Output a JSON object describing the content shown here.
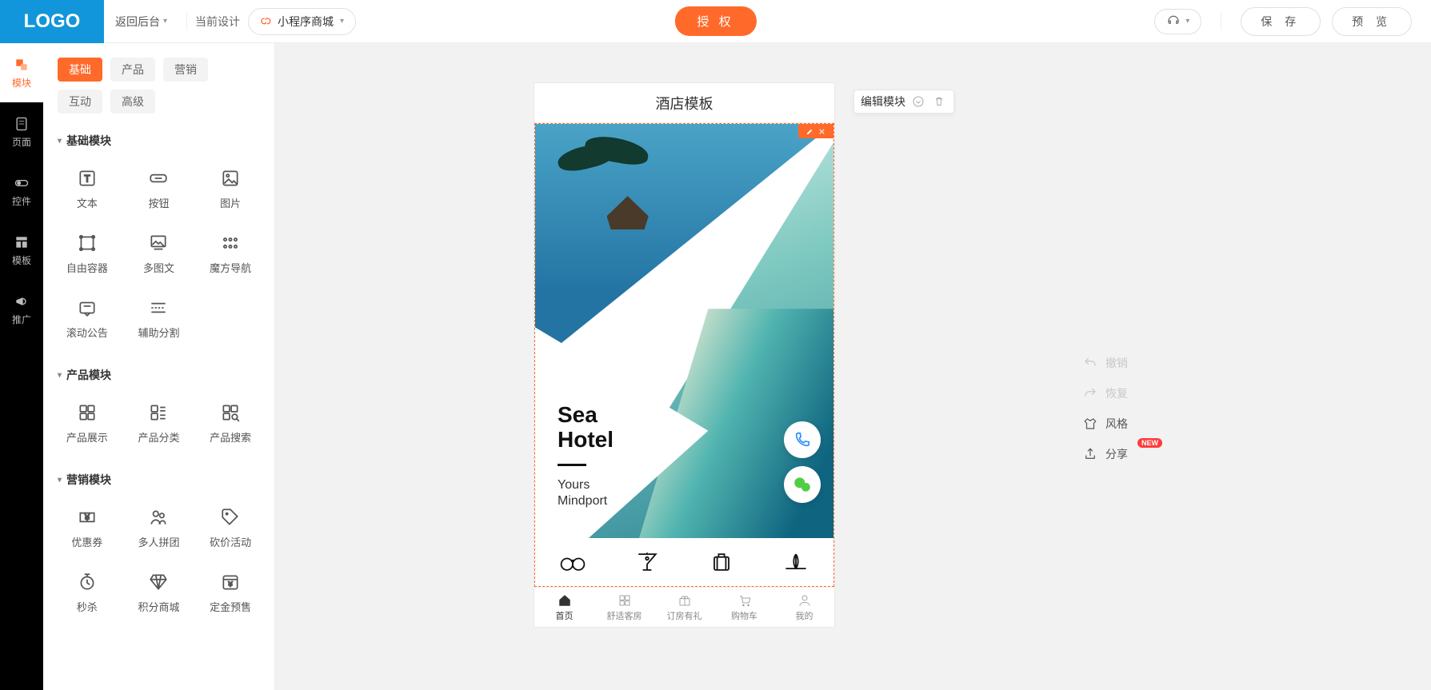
{
  "topbar": {
    "logo": "LOGO",
    "back": "返回后台",
    "cur_label": "当前设计",
    "design_name": "小程序商城",
    "center_btn": "授 权",
    "save": "保 存",
    "preview": "预 览"
  },
  "rail": [
    {
      "label": "模块",
      "active": true
    },
    {
      "label": "页面",
      "active": false
    },
    {
      "label": "控件",
      "active": false
    },
    {
      "label": "模板",
      "active": false
    },
    {
      "label": "推广",
      "active": false
    }
  ],
  "tabs": {
    "row1": [
      "基础",
      "产品",
      "营销",
      "互动"
    ],
    "row2": [
      "高级"
    ],
    "active": "基础"
  },
  "sections": [
    {
      "title": "基础模块",
      "items": [
        "文本",
        "按钮",
        "图片",
        "自由容器",
        "多图文",
        "魔方导航",
        "滚动公告",
        "辅助分割"
      ]
    },
    {
      "title": "产品模块",
      "items": [
        "产品展示",
        "产品分类",
        "产品搜索"
      ]
    },
    {
      "title": "营销模块",
      "items": [
        "优惠券",
        "多人拼团",
        "砍价活动",
        "秒杀",
        "积分商城",
        "定金预售"
      ]
    }
  ],
  "phone": {
    "title": "酒店模板",
    "edit_label": "编辑模块",
    "hero_title1": "Sea",
    "hero_title2": "Hotel",
    "hero_sub1": "Yours",
    "hero_sub2": "Mindport",
    "tabs": [
      "首页",
      "舒适客房",
      "订房有礼",
      "购物车",
      "我的"
    ]
  },
  "right_tools": {
    "undo": "撤销",
    "redo": "恢复",
    "style": "风格",
    "share": "分享",
    "new": "NEW"
  }
}
